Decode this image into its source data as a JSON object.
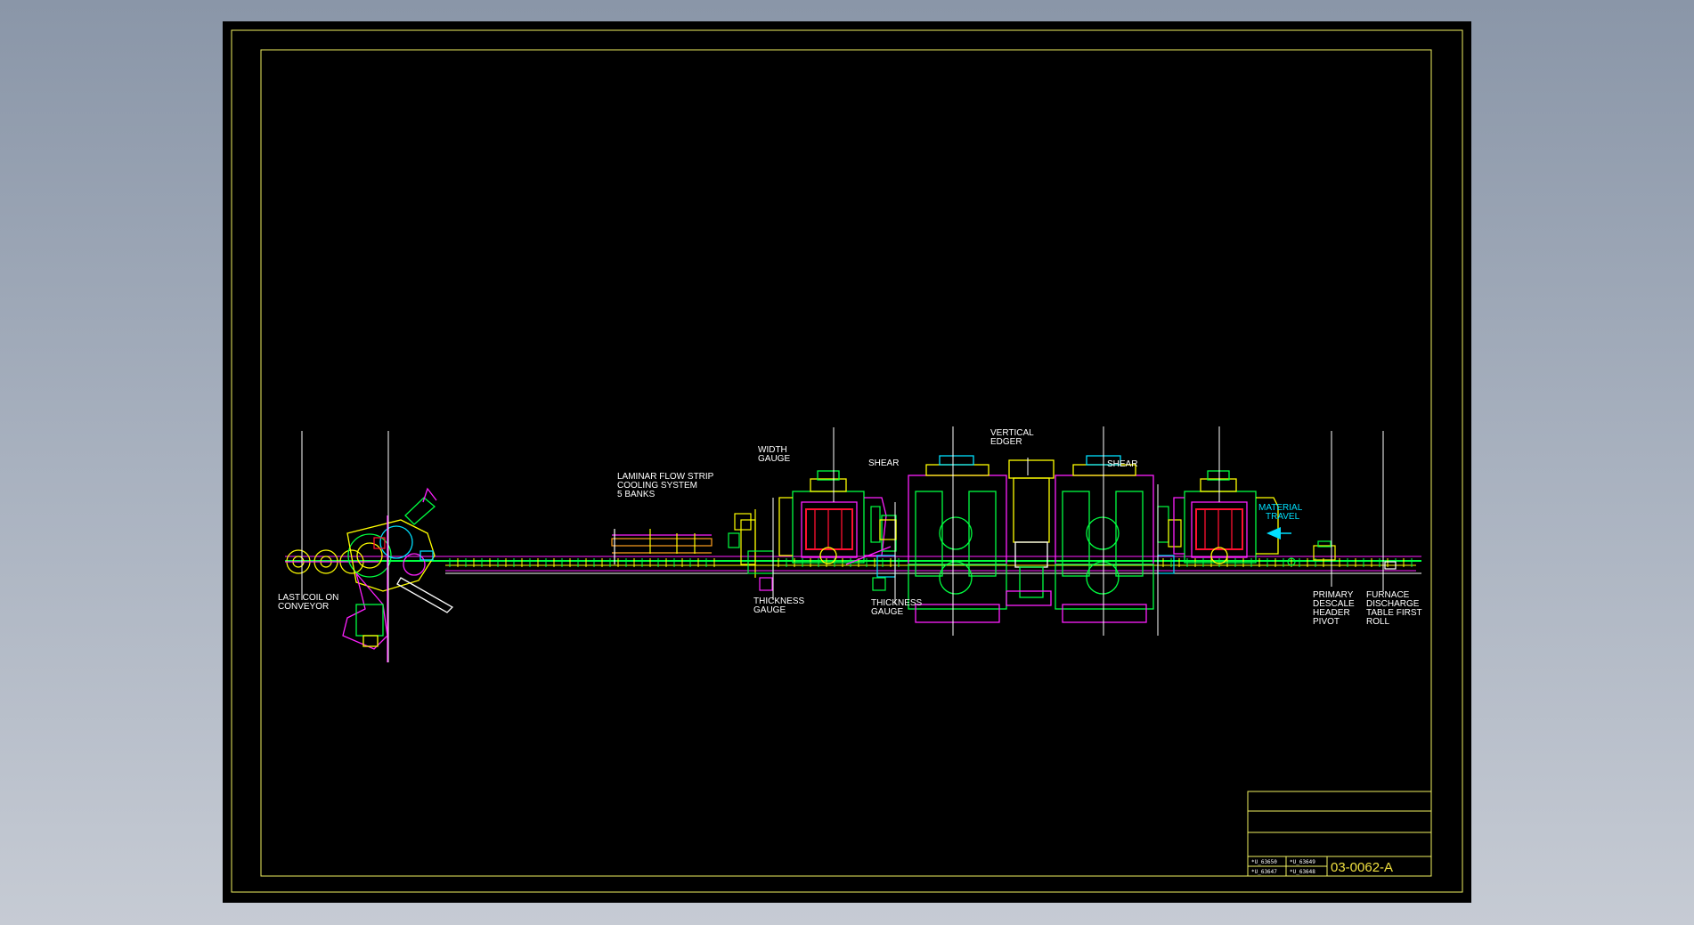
{
  "drawing": {
    "labels": {
      "last_coil": [
        "LAST COIL ON",
        "CONVEYOR"
      ],
      "laminar": [
        "LAMINAR FLOW STRIP",
        "COOLING SYSTEM",
        "5 BANKS"
      ],
      "width_gauge": [
        "WIDTH",
        "GAUGE"
      ],
      "thickness_gauge_1": [
        "THICKNESS",
        "GAUGE"
      ],
      "shear_1": [
        "SHEAR"
      ],
      "thickness_gauge_2": [
        "THICKNESS",
        "GAUGE"
      ],
      "vertical_edger": [
        "VERTICAL",
        "EDGER"
      ],
      "shear_2": [
        "SHEAR"
      ],
      "material_travel": [
        "MATERIAL",
        "TRAVEL"
      ],
      "primary_descale": [
        "PRIMARY",
        "DESCALE",
        "HEADER",
        "PIVOT"
      ],
      "furnace_discharge": [
        "FURNACE",
        "DISCHARGE",
        "TABLE FIRST",
        "ROLL"
      ]
    },
    "title_block": {
      "drawing_number": "03-0062-A",
      "refs": [
        "*U_63650",
        "*U_63649",
        "*U_63647",
        "*U_63648"
      ]
    },
    "colors": {
      "frame": "#f0f060",
      "yellow": "#ffff00",
      "green": "#00ff40",
      "magenta": "#ff20ff",
      "red": "#ff1030",
      "cyan": "#00e0ff",
      "white": "#ffffff",
      "blue": "#4060ff"
    }
  }
}
